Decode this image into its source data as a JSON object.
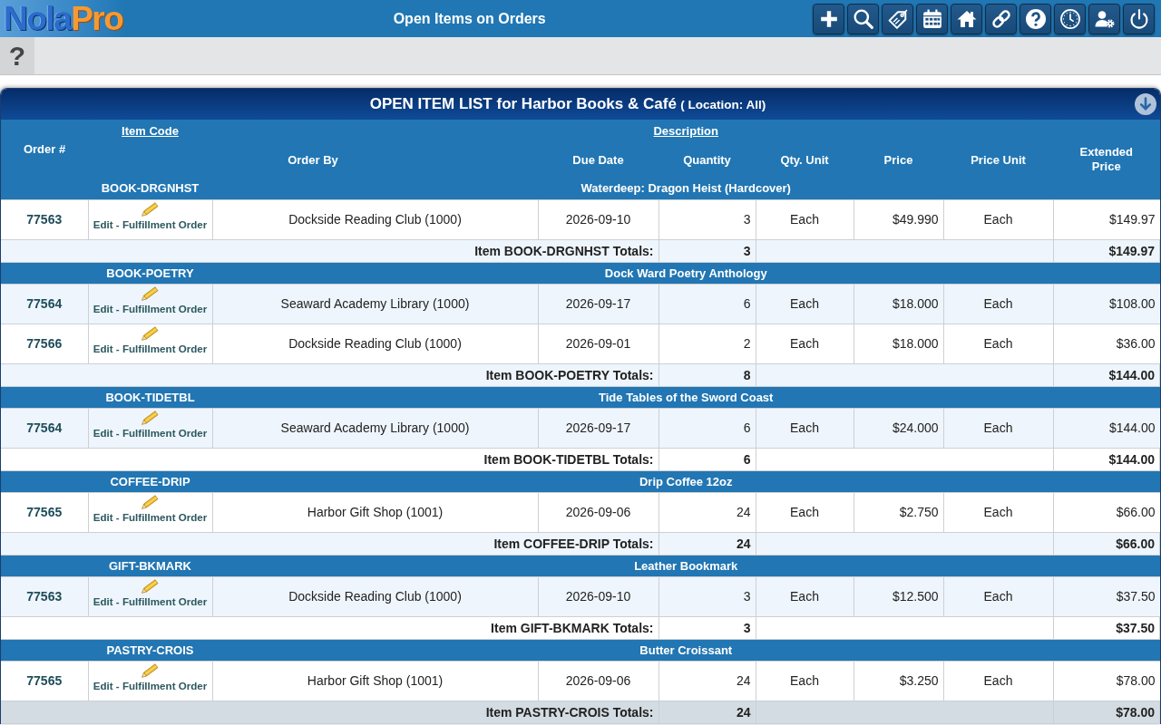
{
  "app_bar": {
    "logo": {
      "lead": "Nola",
      "tail": "Pro"
    },
    "title": "Open Items on Orders",
    "tools": [
      {
        "kind": "add"
      },
      {
        "kind": "search"
      },
      {
        "kind": "tag"
      },
      {
        "kind": "calendar"
      },
      {
        "kind": "home"
      },
      {
        "kind": "link"
      },
      {
        "kind": "help"
      },
      {
        "kind": "clock"
      },
      {
        "kind": "user_settings"
      },
      {
        "kind": "power"
      }
    ]
  },
  "sub_bar": {
    "help_tab": "?"
  },
  "panel": {
    "title": "OPEN ITEM LIST for Harbor Books & Café",
    "location": "( Location: All)"
  },
  "table": {
    "columns": {
      "order_no": "Order #",
      "item_code": "Item Code",
      "description": "Description",
      "order_by": "Order By",
      "due_date": "Due Date",
      "quantity": "Quantity",
      "qty_unit": "Qty. Unit",
      "price": "Price",
      "price_unit": "Price Unit",
      "extended_price": "Extended Price"
    },
    "groups": [
      {
        "code": "BOOK-DRGNHST",
        "description": "Waterdeep: Dragon Heist (Hardcover)",
        "orders": [
          {
            "order_no": "77563",
            "edit_link": "Edit - Fulfillment Order",
            "order_by": "Dockside Reading Club (1000)",
            "due_date": "2026-09-10",
            "quantity": "3",
            "qty_unit": "Each",
            "price": "$49.990",
            "price_unit": "Each",
            "extended_price": "$149.97",
            "striped": false
          }
        ],
        "totals": {
          "label": "Item BOOK-DRGNHST Totals:",
          "quantity": "3",
          "extended_price": "$149.97",
          "striped": true,
          "highlighted": false
        }
      },
      {
        "code": "BOOK-POETRY",
        "description": "Dock Ward Poetry Anthology",
        "orders": [
          {
            "order_no": "77564",
            "edit_link": "Edit - Fulfillment Order",
            "order_by": "Seaward Academy Library (1000)",
            "due_date": "2026-09-17",
            "quantity": "6",
            "qty_unit": "Each",
            "price": "$18.000",
            "price_unit": "Each",
            "extended_price": "$108.00",
            "striped": true
          },
          {
            "order_no": "77566",
            "edit_link": "Edit - Fulfillment Order",
            "order_by": "Dockside Reading Club (1000)",
            "due_date": "2026-09-01",
            "quantity": "2",
            "qty_unit": "Each",
            "price": "$18.000",
            "price_unit": "Each",
            "extended_price": "$36.00",
            "striped": false
          }
        ],
        "totals": {
          "label": "Item BOOK-POETRY Totals:",
          "quantity": "8",
          "extended_price": "$144.00",
          "striped": true,
          "highlighted": false
        }
      },
      {
        "code": "BOOK-TIDETBL",
        "description": "Tide Tables of the Sword Coast",
        "orders": [
          {
            "order_no": "77564",
            "edit_link": "Edit - Fulfillment Order",
            "order_by": "Seaward Academy Library (1000)",
            "due_date": "2026-09-17",
            "quantity": "6",
            "qty_unit": "Each",
            "price": "$24.000",
            "price_unit": "Each",
            "extended_price": "$144.00",
            "striped": true
          }
        ],
        "totals": {
          "label": "Item BOOK-TIDETBL Totals:",
          "quantity": "6",
          "extended_price": "$144.00",
          "striped": false,
          "highlighted": false
        }
      },
      {
        "code": "COFFEE-DRIP",
        "description": "Drip Coffee 12oz",
        "orders": [
          {
            "order_no": "77565",
            "edit_link": "Edit - Fulfillment Order",
            "order_by": "Harbor Gift Shop (1001)",
            "due_date": "2026-09-06",
            "quantity": "24",
            "qty_unit": "Each",
            "price": "$2.750",
            "price_unit": "Each",
            "extended_price": "$66.00",
            "striped": false
          }
        ],
        "totals": {
          "label": "Item COFFEE-DRIP Totals:",
          "quantity": "24",
          "extended_price": "$66.00",
          "striped": true,
          "highlighted": false
        }
      },
      {
        "code": "GIFT-BKMARK",
        "description": "Leather Bookmark",
        "orders": [
          {
            "order_no": "77563",
            "edit_link": "Edit - Fulfillment Order",
            "order_by": "Dockside Reading Club (1000)",
            "due_date": "2026-09-10",
            "quantity": "3",
            "qty_unit": "Each",
            "price": "$12.500",
            "price_unit": "Each",
            "extended_price": "$37.50",
            "striped": true
          }
        ],
        "totals": {
          "label": "Item GIFT-BKMARK Totals:",
          "quantity": "3",
          "extended_price": "$37.50",
          "striped": false,
          "highlighted": false
        }
      },
      {
        "code": "PASTRY-CROIS",
        "description": "Butter Croissant",
        "orders": [
          {
            "order_no": "77565",
            "edit_link": "Edit - Fulfillment Order",
            "order_by": "Harbor Gift Shop (1001)",
            "due_date": "2026-09-06",
            "quantity": "24",
            "qty_unit": "Each",
            "price": "$3.250",
            "price_unit": "Each",
            "extended_price": "$78.00",
            "striped": false
          }
        ],
        "totals": {
          "label": "Item PASTRY-CROIS Totals:",
          "quantity": "24",
          "extended_price": "$78.00",
          "highlighted": true
        }
      }
    ]
  }
}
